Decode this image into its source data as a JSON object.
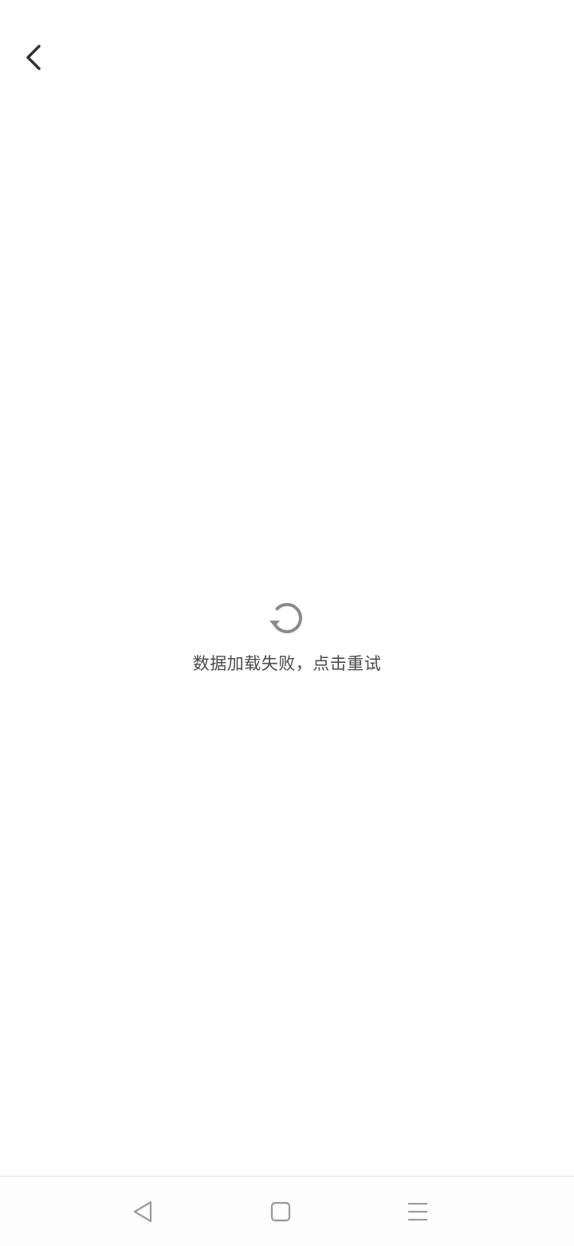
{
  "header": {
    "back_icon": "chevron-left-icon"
  },
  "error_state": {
    "icon": "refresh-icon",
    "message": "数据加载失败，点击重试"
  },
  "system_nav": {
    "back_icon": "triangle-back-icon",
    "home_icon": "square-home-icon",
    "menu_icon": "menu-lines-icon"
  },
  "colors": {
    "background": "#ffffff",
    "text": "#4a4a4a",
    "icon_dark": "#333333",
    "icon_gray": "#8a8a8a",
    "nav_icon": "#9a9a9a"
  }
}
